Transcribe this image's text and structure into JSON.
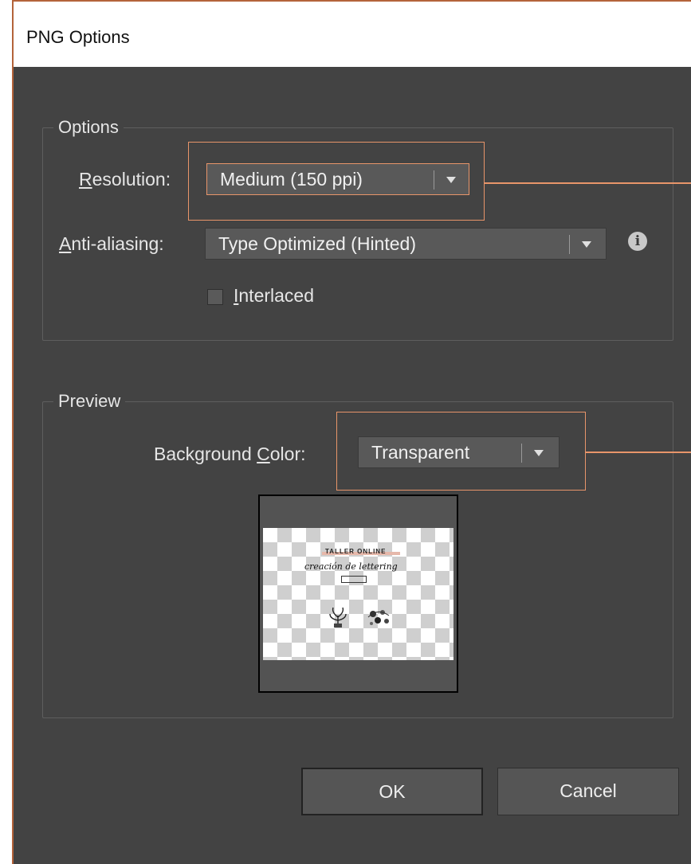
{
  "dialog": {
    "title": "PNG Options"
  },
  "options": {
    "legend": "Options",
    "resolution": {
      "label_mnemonic": "R",
      "label_rest": "esolution:",
      "value": "Medium (150 ppi)"
    },
    "antialiasing": {
      "label_mnemonic": "A",
      "label_rest": "nti-aliasing:",
      "value": "Type Optimized (Hinted)"
    },
    "interlaced": {
      "label_mnemonic": "I",
      "label_rest": "nterlaced",
      "checked": false
    }
  },
  "preview": {
    "legend": "Preview",
    "background_color": {
      "label_before": "Background ",
      "label_mnemonic": "C",
      "label_rest": "olor:",
      "value": "Transparent"
    },
    "artwork": {
      "title": "TALLER ONLINE",
      "script": "creación de lettering"
    }
  },
  "buttons": {
    "ok": "OK",
    "cancel": "Cancel"
  },
  "colors": {
    "highlight": "#e8956a",
    "dialog_bg": "#434343",
    "window_border": "#b4633a"
  },
  "icons": {
    "info": "info-icon",
    "dropdown": "chevron-down-icon"
  }
}
